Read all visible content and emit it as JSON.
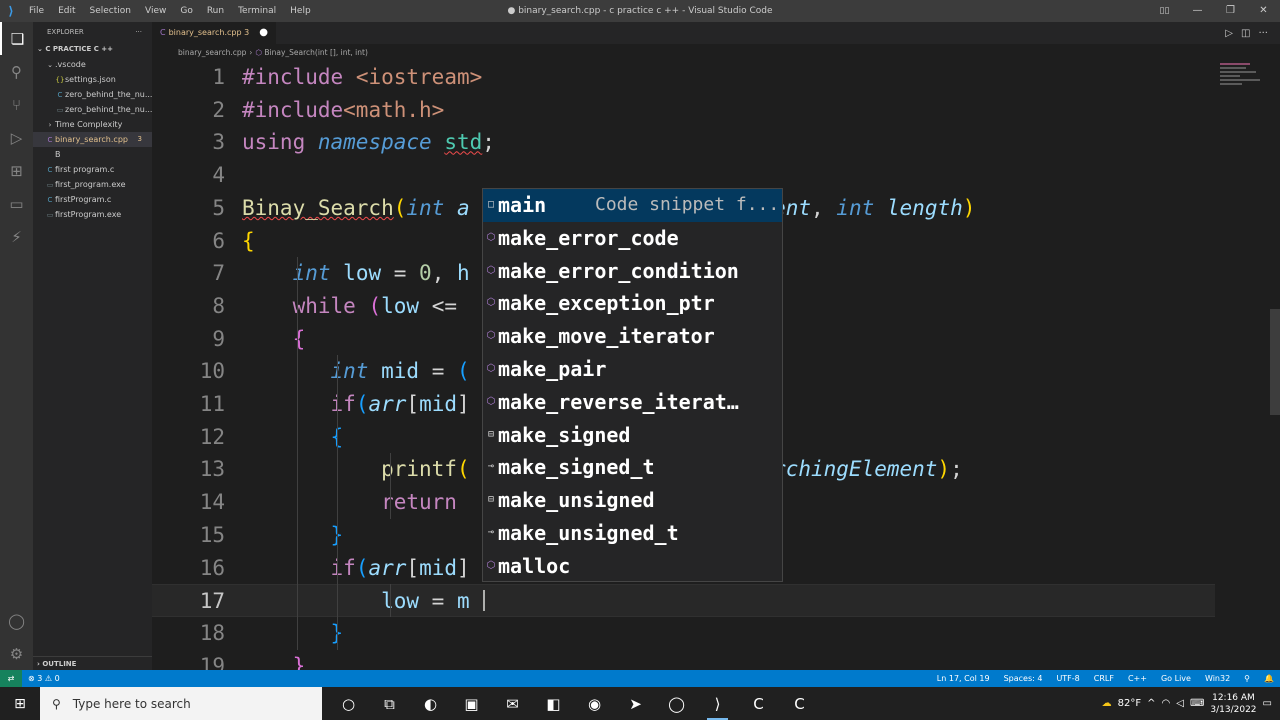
{
  "window": {
    "title": "● binary_search.cpp - c practice c ++ - Visual Studio Code",
    "menu": [
      "File",
      "Edit",
      "Selection",
      "View",
      "Go",
      "Run",
      "Terminal",
      "Help"
    ],
    "controls": [
      "—",
      "❐",
      "✕"
    ]
  },
  "sidebar": {
    "header": "EXPLORER",
    "dots": "···",
    "section": "C PRACTICE C ++",
    "items": [
      {
        "label": ".vscode",
        "indent": 1,
        "icon": "chevron-down-icon",
        "glyph": "⌄",
        "cls": ""
      },
      {
        "label": "settings.json",
        "indent": 2,
        "icon": "json-file-icon",
        "glyph": "{}",
        "cls": "ico-json"
      },
      {
        "label": "zero_behind_the_nu...",
        "indent": 2,
        "icon": "c-file-icon",
        "glyph": "C",
        "cls": "ico-c"
      },
      {
        "label": "zero_behind_the_nu...",
        "indent": 2,
        "icon": "exe-file-icon",
        "glyph": "▭",
        "cls": "ico-exe"
      },
      {
        "label": "Time Complexity",
        "indent": 1,
        "icon": "chevron-right-icon",
        "glyph": "›",
        "cls": ""
      },
      {
        "label": "binary_search.cpp",
        "indent": 1,
        "icon": "cpp-file-icon",
        "glyph": "C",
        "cls": "ico-cpp",
        "selected": true,
        "badge": "3"
      },
      {
        "label": "B",
        "indent": 1,
        "icon": "file-icon",
        "glyph": "",
        "cls": ""
      },
      {
        "label": "first program.c",
        "indent": 1,
        "icon": "c-file-icon",
        "glyph": "C",
        "cls": "ico-c"
      },
      {
        "label": "first_program.exe",
        "indent": 1,
        "icon": "exe-file-icon",
        "glyph": "▭",
        "cls": "ico-exe"
      },
      {
        "label": "firstProgram.c",
        "indent": 1,
        "icon": "c-file-icon",
        "glyph": "C",
        "cls": "ico-c"
      },
      {
        "label": "firstProgram.exe",
        "indent": 1,
        "icon": "exe-file-icon",
        "glyph": "▭",
        "cls": "ico-exe"
      }
    ],
    "outline": "OUTLINE"
  },
  "tab": {
    "label": "binary_search.cpp",
    "badge": "3",
    "dirty": "●"
  },
  "breadcrumb": {
    "file": "binary_search.cpp",
    "symbol": "Binay_Search(int [], int, int)"
  },
  "editor": {
    "lines": [
      {
        "n": "1",
        "html": "<span class='pp'>#include</span> <span class='inc'>&lt;iostream&gt;</span>"
      },
      {
        "n": "2",
        "html": "<span class='pp'>#include</span><span class='inc'>&lt;math.h&gt;</span>"
      },
      {
        "n": "3",
        "html": "<span class='kw'>using</span> <span class='kwi'>namespace</span> <span class='ty squig'>std</span>;"
      },
      {
        "n": "4",
        "html": ""
      },
      {
        "n": "5",
        "html": "<span class='fn squig'>Binay_Search</span><span class='br1'>(</span><span class='kwi'>int</span> <span class='vari'>a</span>                       <span class='vari'>ment</span>, <span class='kwi'>int</span> <span class='vari'>length</span><span class='br1'>)</span>"
      },
      {
        "n": "6",
        "html": "<span class='br1'>{</span>"
      },
      {
        "n": "7",
        "html": "    <span class='kwi'>int</span> <span class='var'>low</span> = <span class='num'>0</span>, <span class='var'>h</span>"
      },
      {
        "n": "8",
        "html": "    <span class='kw'>while</span> <span class='br2'>(</span><span class='var'>low</span> &lt;="
      },
      {
        "n": "9",
        "html": "    <span class='br2'>{</span>"
      },
      {
        "n": "10",
        "html": "       <span class='kwi'>int</span> <span class='var'>mid</span> = <span class='br3'>(</span>"
      },
      {
        "n": "11",
        "html": "       <span class='kw'>if</span><span class='br3'>(</span><span class='vari'>arr</span>[<span class='var'>mid</span>]"
      },
      {
        "n": "12",
        "html": "       <span class='br3'>{</span>"
      },
      {
        "n": "13",
        "html": "           <span class='fn'>printf</span><span class='br1'>(</span>                 <span class='str'>d\"</span>, <span class='vari'>SearchingElement</span><span class='br1'>)</span>;"
      },
      {
        "n": "14",
        "html": "           <span class='kw'>return</span>"
      },
      {
        "n": "15",
        "html": "       <span class='br3'>}</span>"
      },
      {
        "n": "16",
        "html": "       <span class='kw'>if</span><span class='br3'>(</span><span class='vari'>arr</span>[<span class='var'>mid</span>]"
      },
      {
        "n": "17",
        "html": "           <span class='var'>low</span> = <span class='var'>m</span>",
        "current": true
      },
      {
        "n": "18",
        "html": "       <span class='br3'>}</span>"
      },
      {
        "n": "19",
        "html": "    <span class='br2'>}</span>"
      }
    ]
  },
  "suggest": [
    {
      "label": "main",
      "kind": "snippet-icon",
      "glyph": "□",
      "cls": "snip",
      "detail": "Code snippet f...",
      "selected": true
    },
    {
      "label": "make_error_code",
      "kind": "method-icon",
      "glyph": "⬡",
      "cls": ""
    },
    {
      "label": "make_error_condition",
      "kind": "method-icon",
      "glyph": "⬡",
      "cls": ""
    },
    {
      "label": "make_exception_ptr",
      "kind": "method-icon",
      "glyph": "⬡",
      "cls": ""
    },
    {
      "label": "make_move_iterator",
      "kind": "method-icon",
      "glyph": "⬡",
      "cls": ""
    },
    {
      "label": "make_pair",
      "kind": "method-icon",
      "glyph": "⬡",
      "cls": ""
    },
    {
      "label": "make_reverse_iterat…",
      "kind": "method-icon",
      "glyph": "⬡",
      "cls": ""
    },
    {
      "label": "make_signed",
      "kind": "struct-icon",
      "glyph": "⊟",
      "cls": "snip"
    },
    {
      "label": "make_signed_t",
      "kind": "typedef-icon",
      "glyph": "⊸",
      "cls": "snip"
    },
    {
      "label": "make_unsigned",
      "kind": "struct-icon",
      "glyph": "⊟",
      "cls": "snip"
    },
    {
      "label": "make_unsigned_t",
      "kind": "typedef-icon",
      "glyph": "⊸",
      "cls": "snip"
    },
    {
      "label": "malloc",
      "kind": "method-icon",
      "glyph": "⬡",
      "cls": ""
    }
  ],
  "statusbar": {
    "remote": "⇄",
    "problems": "⊗ 3 ⚠ 0",
    "right": [
      "Ln 17, Col 19",
      "Spaces: 4",
      "UTF-8",
      "CRLF",
      "C++",
      "Go Live",
      "Win32",
      "⚲",
      "🔔"
    ]
  },
  "taskbar": {
    "search_placeholder": "Type here to search",
    "apps": [
      {
        "name": "cortana-icon",
        "glyph": "○"
      },
      {
        "name": "task-view-icon",
        "glyph": "⧉"
      },
      {
        "name": "edge-icon",
        "glyph": "◐"
      },
      {
        "name": "store-icon",
        "glyph": "▣"
      },
      {
        "name": "mail-icon",
        "glyph": "✉"
      },
      {
        "name": "office-icon",
        "glyph": "◧"
      },
      {
        "name": "firefox-icon",
        "glyph": "◉"
      },
      {
        "name": "telegram-icon",
        "glyph": "➤"
      },
      {
        "name": "opera-icon",
        "glyph": "◯"
      },
      {
        "name": "vscode-icon",
        "glyph": "⟩",
        "active": true
      },
      {
        "name": "codeblocks-icon",
        "glyph": "C"
      },
      {
        "name": "clion-icon",
        "glyph": "C"
      }
    ],
    "weather": "82°F",
    "time": "12:16 AM",
    "date": "3/13/2022"
  },
  "colors": {
    "accent": "#007acc",
    "selection": "#04395e"
  }
}
